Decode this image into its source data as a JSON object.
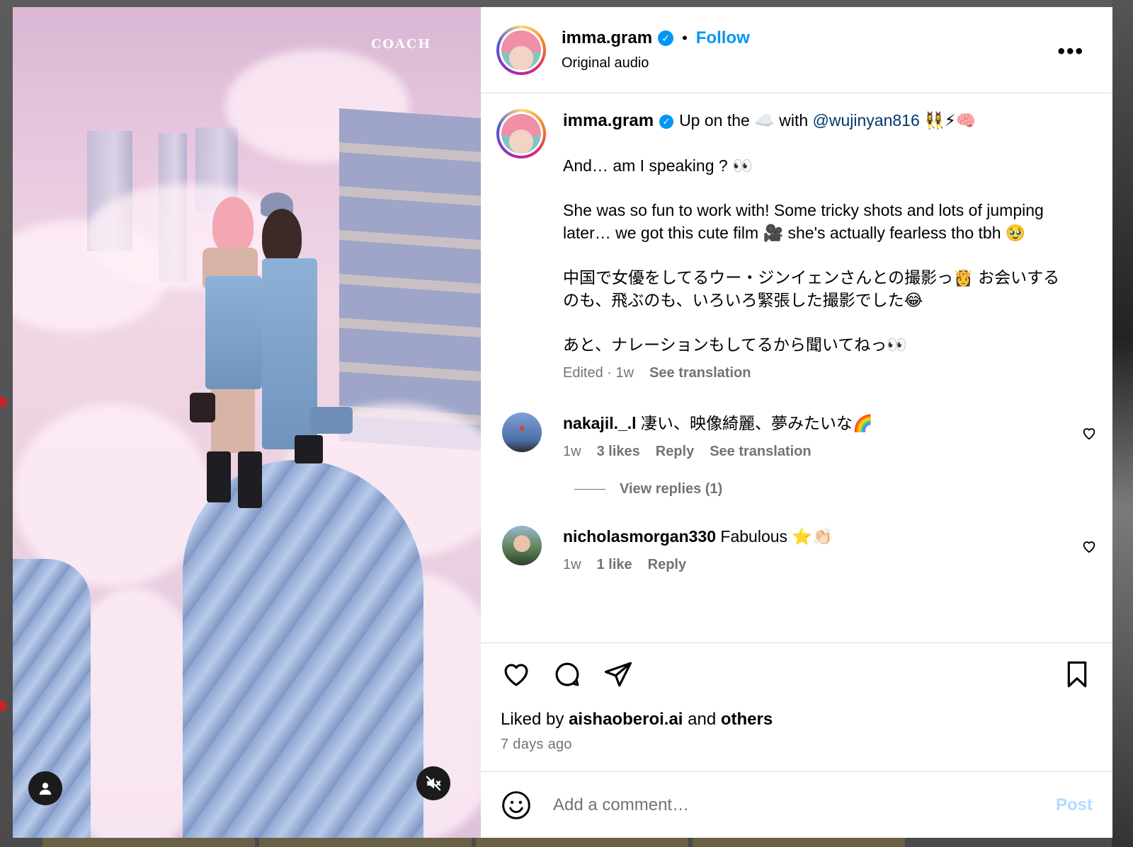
{
  "post": {
    "brand_watermark": "COACH",
    "author": "imma.gram",
    "follow_label": "Follow",
    "separator": "•",
    "audio": "Original audio",
    "more_label": "•••"
  },
  "caption": {
    "author": "imma.gram",
    "line1_pre": "Up on the ☁️ with ",
    "mention": "@wujinyan816",
    "line1_post": " 👯‍♀️⚡🧠",
    "para2": "And… am I speaking ? 👀",
    "para3": "She was so fun to work with! Some tricky shots and lots of jumping later… we got this cute film 🎥 she's actually fearless tho tbh 🥹",
    "para4": "中国で女優をしてるウー・ジンイェンさんとの撮影っ👸 お会いするのも、飛ぶのも、いろいろ緊張した撮影でした😂",
    "para5": "あと、ナレーションもしてるから聞いてねっ👀",
    "edited": "Edited · 1w",
    "see_translation": "See translation"
  },
  "comments": [
    {
      "user": "nakajil._.l",
      "text": "凄い、映像綺麗、夢みたいな🌈",
      "time": "1w",
      "likes": "3 likes",
      "reply": "Reply",
      "see_translation": "See translation",
      "view_replies": "View replies (1)"
    },
    {
      "user": "nicholasmorgan330",
      "text": "Fabulous ⭐👏🏻",
      "time": "1w",
      "likes": "1 like",
      "reply": "Reply"
    }
  ],
  "engagement": {
    "liked_by_prefix": "Liked by ",
    "liked_by_user": "aishaoberoi.ai",
    "liked_by_and": " and ",
    "liked_by_others": "others",
    "time_ago": "7 days ago"
  },
  "composer": {
    "placeholder": "Add a comment…",
    "post_label": "Post"
  },
  "colors": {
    "accent": "#0095f6",
    "mention": "#00376b",
    "muted": "#737373",
    "post_disabled": "#b3dbff"
  },
  "icons": [
    "user-icon",
    "mute-icon",
    "verified-icon",
    "more-icon",
    "heart-icon",
    "comment-icon",
    "share-icon",
    "bookmark-icon",
    "emoji-icon"
  ]
}
